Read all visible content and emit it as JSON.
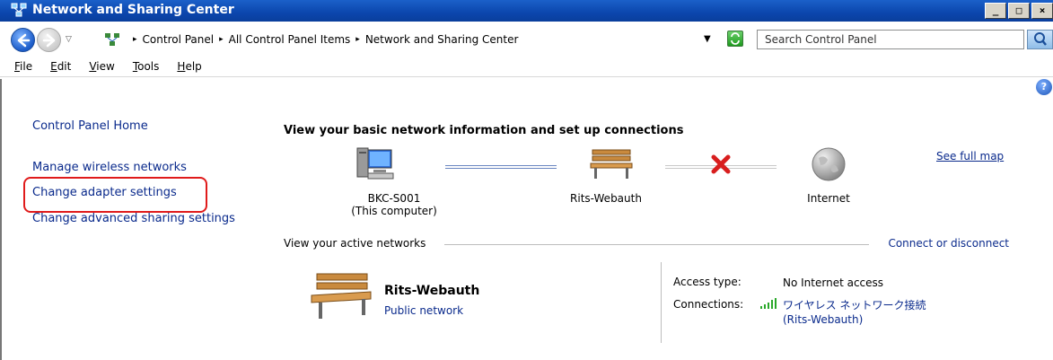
{
  "window": {
    "title": "Network and Sharing Center",
    "min_glyph": "_",
    "max_glyph": "□",
    "close_glyph": "×"
  },
  "address": {
    "crumbs": [
      "Control Panel",
      "All Control Panel Items",
      "Network and Sharing Center"
    ],
    "separator": "▸",
    "search_placeholder": "Search Control Panel"
  },
  "menu": [
    {
      "label": "File",
      "key": "F",
      "rest": "ile"
    },
    {
      "label": "Edit",
      "key": "E",
      "rest": "dit"
    },
    {
      "label": "View",
      "key": "V",
      "rest": "iew"
    },
    {
      "label": "Tools",
      "key": "T",
      "rest": "ools"
    },
    {
      "label": "Help",
      "key": "H",
      "rest": "elp"
    }
  ],
  "sidebar": {
    "home": "Control Panel Home",
    "items": [
      {
        "label": "Manage wireless networks"
      },
      {
        "label": "Change adapter settings"
      },
      {
        "label": "Change advanced sharing settings"
      }
    ]
  },
  "main": {
    "heading": "View your basic network information and set up connections",
    "see_full_map": "See full map",
    "map": {
      "computer_name": "BKC-S001",
      "computer_sub": "(This computer)",
      "network_name": "Rits-Webauth",
      "internet": "Internet"
    },
    "active_networks_label": "View your active networks",
    "connect_label": "Connect or disconnect",
    "active": {
      "name": "Rits-Webauth",
      "type": "Public network",
      "access_label": "Access type:",
      "access_value": "No Internet access",
      "connections_label": "Connections:",
      "connection_name": "ワイヤレス ネットワーク接続",
      "connection_sub": "(Rits-Webauth)"
    }
  },
  "colors": {
    "titlebar": "#0b46ad",
    "link": "#0a2a8c",
    "highlight": "#e01b1b"
  }
}
